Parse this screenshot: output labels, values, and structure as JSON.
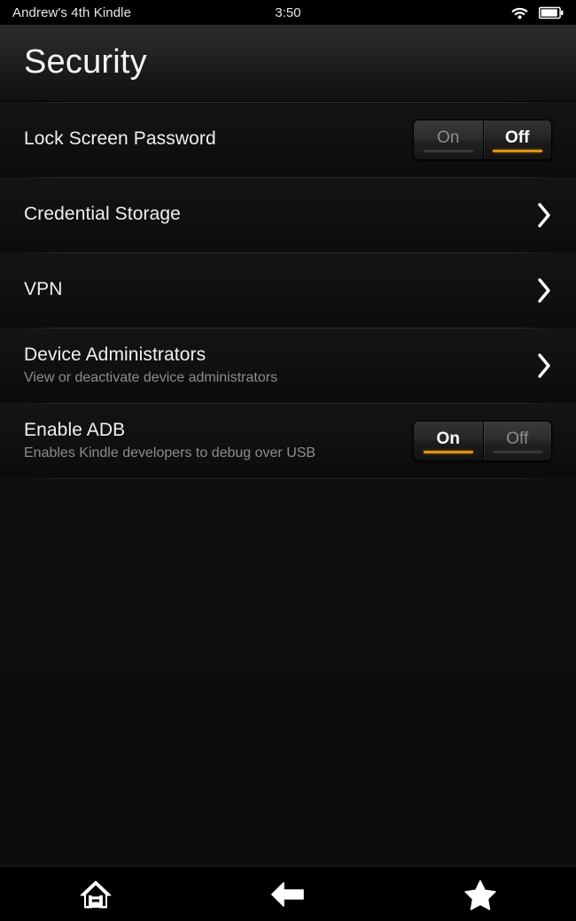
{
  "statusbar": {
    "device_name": "Andrew's 4th Kindle",
    "clock": "3:50",
    "wifi_icon": "wifi-icon",
    "battery_icon": "battery-icon"
  },
  "header": {
    "title": "Security"
  },
  "colors": {
    "accent": "#e09113",
    "background": "#0d0d0d",
    "text_primary": "#f0f0f0",
    "text_secondary": "#8c8c8c",
    "navbar": "#000000"
  },
  "settings": {
    "rows": [
      {
        "title": "Lock Screen Password",
        "subtitle": "",
        "accessory": "toggle",
        "toggle": {
          "on_label": "On",
          "off_label": "Off",
          "value": "Off"
        },
        "name": "lock-screen-password"
      },
      {
        "title": "Credential Storage",
        "subtitle": "",
        "accessory": "chevron",
        "name": "credential-storage"
      },
      {
        "title": "VPN",
        "subtitle": "",
        "accessory": "chevron",
        "name": "vpn"
      },
      {
        "title": "Device Administrators",
        "subtitle": "View or deactivate device administrators",
        "accessory": "chevron",
        "name": "device-administrators"
      },
      {
        "title": "Enable ADB",
        "subtitle": "Enables Kindle developers to debug over USB",
        "accessory": "toggle",
        "toggle": {
          "on_label": "On",
          "off_label": "Off",
          "value": "On"
        },
        "name": "enable-adb"
      }
    ]
  },
  "navbar": {
    "items": [
      {
        "icon": "home-icon",
        "label": "Home"
      },
      {
        "icon": "back-arrow-icon",
        "label": "Back"
      },
      {
        "icon": "star-icon",
        "label": "Favorites"
      }
    ]
  }
}
